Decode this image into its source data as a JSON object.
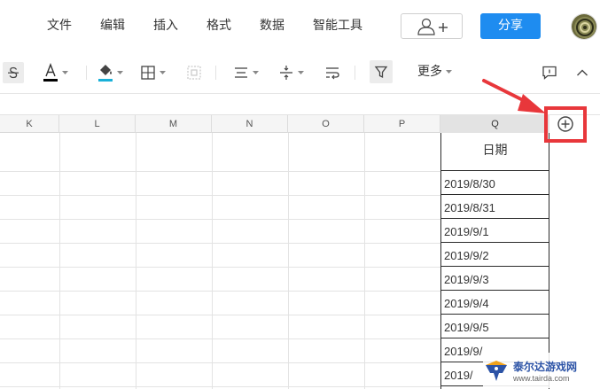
{
  "menu": {
    "items": [
      "文件",
      "编辑",
      "插入",
      "格式",
      "数据",
      "智能工具"
    ],
    "share_label": "分享"
  },
  "toolbar": {
    "more_label": "更多",
    "font_color": "#000000",
    "fill_color": "#19b0d8"
  },
  "sheet": {
    "columns": [
      "K",
      "L",
      "M",
      "N",
      "O",
      "P",
      "Q"
    ],
    "selected_column": "Q",
    "date_header": "日期",
    "dates": [
      "2019/8/30",
      "2019/8/31",
      "2019/9/1",
      "2019/9/2",
      "2019/9/3",
      "2019/9/4",
      "2019/9/5",
      "2019/9/",
      "2019/"
    ]
  },
  "annotation": {
    "highlight_color": "#e8373b",
    "add_column_icon": "plus-circle-icon"
  },
  "watermark": {
    "title": "泰尔达游戏网",
    "url": "www.tairda.com"
  },
  "colors": {
    "share_button": "#1e8cf0",
    "grid_line": "#e3e3e3",
    "selected_border": "#2b2b2b"
  }
}
